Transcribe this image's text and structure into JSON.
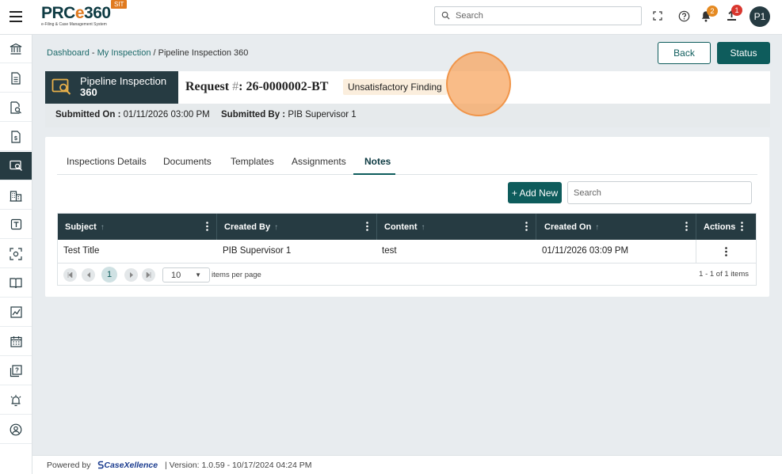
{
  "app": {
    "logo_text_a": "PRC",
    "logo_text_e": "e",
    "logo_text_b": "360",
    "logo_subtitle": "e-Filing & Case Management System",
    "env_badge": "SIT"
  },
  "topbar": {
    "search_placeholder": "Search",
    "notifications_count": "2",
    "uploads_count": "1",
    "avatar_initials": "P1"
  },
  "sidebar": {
    "items": [
      "bank-icon",
      "document-icon",
      "document-search-icon",
      "invoice-icon",
      "inspection-icon",
      "building-icon",
      "template-icon",
      "scan-icon",
      "book-icon",
      "chart-icon",
      "calendar-icon",
      "help-doc-icon",
      "alarm-icon",
      "user-circle-icon"
    ],
    "active_index": 4
  },
  "breadcrumb": {
    "link1": "Dashboard",
    "sep1": " - ",
    "link2": "My Inspection",
    "sep2": " / ",
    "current": "Pipeline Inspection 360"
  },
  "actions": {
    "back": "Back",
    "status": "Status"
  },
  "header": {
    "module_title_line1": "Pipeline Inspection",
    "module_title_line2": "360",
    "request_prefix": "Request ",
    "request_hash": "#",
    "request_id": ": 26-0000002-BT",
    "status_chip": "Unsatisfactory Finding"
  },
  "submitted": {
    "on_label": "Submitted On :",
    "on_value": "01/11/2026 03:00 PM",
    "by_label": "Submitted By :",
    "by_value": "PIB Supervisor 1"
  },
  "tabs": [
    "Inspections Details",
    "Documents",
    "Templates",
    "Assignments",
    "Notes"
  ],
  "active_tab": "Notes",
  "notes": {
    "add_new": "+ Add New",
    "search_placeholder": "Search",
    "columns": [
      "Subject",
      "Created By",
      "Content",
      "Created On",
      "Actions"
    ],
    "rows": [
      {
        "subject": "Test Title",
        "created_by": "PIB Supervisor 1",
        "content": "test",
        "created_on": "01/11/2026 03:09 PM"
      }
    ],
    "pager": {
      "current_page": "1",
      "page_size": "10",
      "items_per_page": "items per page",
      "summary": "1 - 1 of 1 items"
    }
  },
  "footer": {
    "powered_by": "Powered by",
    "brand": "CaseXellence",
    "version": "|  Version: 1.0.59 - 10/17/2024 04:24 PM"
  }
}
